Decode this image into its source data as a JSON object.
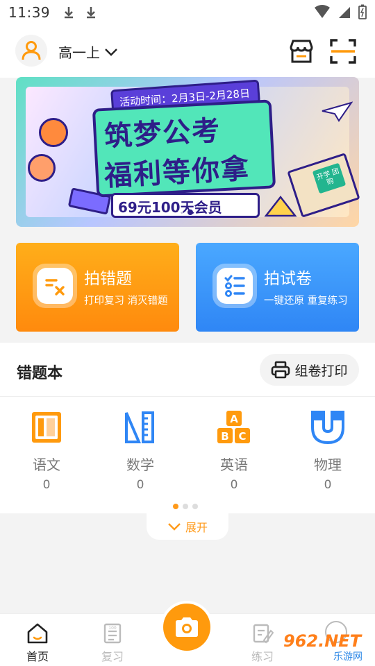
{
  "status_bar": {
    "time": "11:39"
  },
  "header": {
    "grade": "高一上"
  },
  "banner": {
    "date_text": "活动时间：2月3日-2月28日",
    "title_line1": "筑梦公考",
    "title_line2": "福利等你拿",
    "subtitle": "69元100天会员",
    "book_tag": "开学 团购"
  },
  "cards": [
    {
      "title": "拍错题",
      "subtitle": "打印复习 消灭错题"
    },
    {
      "title": "拍试卷",
      "subtitle": "一键还原 重复练习"
    }
  ],
  "error_book": {
    "title": "错题本",
    "print_label": "组卷打印",
    "subjects": [
      {
        "name": "语文",
        "count": "0",
        "icon": "book-icon"
      },
      {
        "name": "数学",
        "count": "0",
        "icon": "ruler-triangle-icon"
      },
      {
        "name": "英语",
        "count": "0",
        "icon": "abc-blocks-icon"
      },
      {
        "name": "物理",
        "count": "0",
        "icon": "magnet-icon"
      }
    ]
  },
  "expand": {
    "label": "展开"
  },
  "bottom_nav": [
    {
      "label": "首页",
      "active": true
    },
    {
      "label": "复习",
      "active": false
    },
    {
      "label": "练习",
      "active": false
    }
  ],
  "watermark": {
    "text": "962.NET",
    "sub": "乐游网"
  },
  "colors": {
    "accent": "#ff9a0d",
    "blue": "#2f86f5",
    "banner_ink": "#2e1e88"
  }
}
